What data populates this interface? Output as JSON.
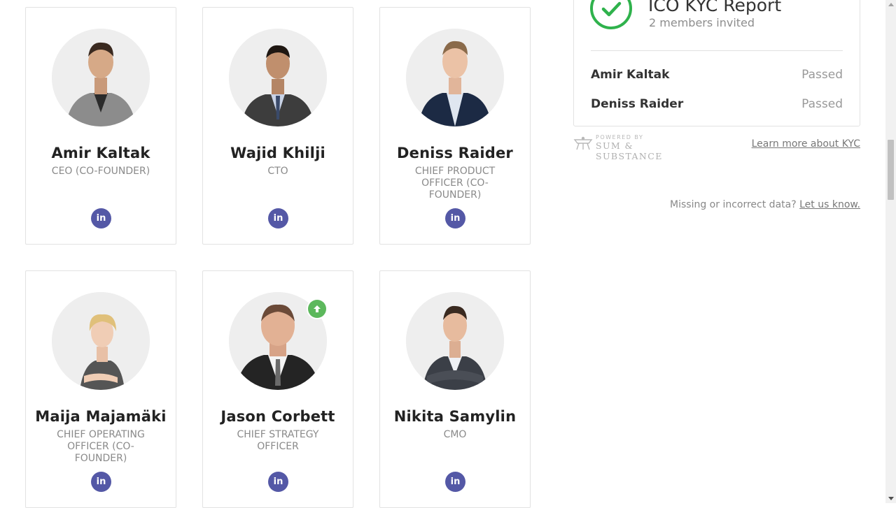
{
  "team": [
    {
      "name": "Amir Kaltak",
      "role": "CEO (CO-FOUNDER)",
      "social": "in"
    },
    {
      "name": "Wajid Khilji",
      "role": "CTO",
      "social": "in"
    },
    {
      "name": "Deniss Raider",
      "role": "CHIEF PRODUCT OFFICER (CO-FOUNDER)",
      "social": "in"
    },
    {
      "name": "Maija Majamäki",
      "role": "CHIEF OPERATING OFFICER (CO-FOUNDER)",
      "social": "in"
    },
    {
      "name": "Jason Corbett",
      "role": "CHIEF STRATEGY OFFICER",
      "social": "in"
    },
    {
      "name": "Nikita Samylin",
      "role": "CMO",
      "social": "in"
    }
  ],
  "kyc": {
    "title": "ICO KYC Report",
    "subtitle": "2 members invited",
    "members": [
      {
        "name": "Amir Kaltak",
        "status": "Passed"
      },
      {
        "name": "Deniss Raider",
        "status": "Passed"
      }
    ],
    "powered_small": "POWERED BY",
    "powered_brand": "SUM & SUBSTANCE",
    "learn_more": "Learn more about KYC"
  },
  "feedback": {
    "text": "Missing or incorrect data?",
    "link": "Let us know."
  },
  "colors": {
    "linkedin": "#5458a6",
    "kyc_check": "#2fb24c",
    "upvote_badge": "#5cb85c"
  }
}
